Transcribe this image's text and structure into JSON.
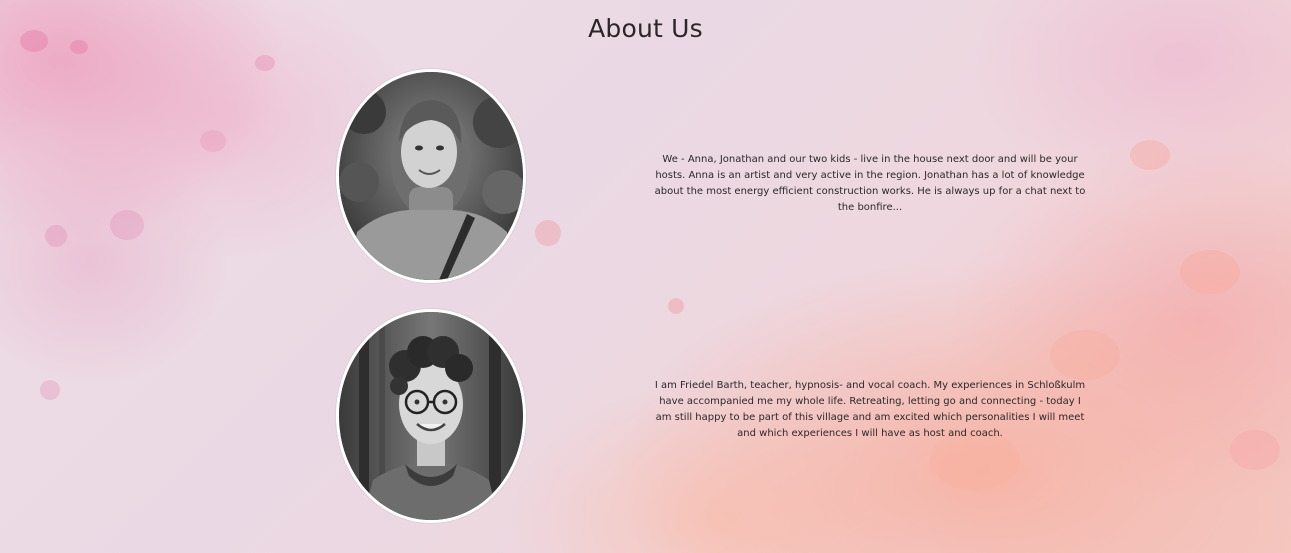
{
  "page": {
    "title": "About Us"
  },
  "team": [
    {
      "photo_icon": "portrait-photo-woman-turtleneck",
      "bio": "We - Anna, Jonathan and our two kids - live in the house next door and will be your hosts. Anna is an artist and very active in the region. Jonathan has a lot of knowledge about the most energy efficient construction works. He is always up for a chat next to the bonfire..."
    },
    {
      "photo_icon": "portrait-photo-woman-glasses",
      "bio": "I am Friedel Barth, teacher, hypnosis- and vocal coach. My experiences in Schloßkulm have accompanied me my whole life. Retreating, letting go and connecting - today I am still happy to be part of this village and am excited which personalities I will meet and which experiences I will have as host and coach."
    }
  ],
  "colors": {
    "text": "#2c2829",
    "portrait_border": "#ffffff",
    "background_pink": "#efdce6",
    "background_peach": "#f4c7c0"
  }
}
